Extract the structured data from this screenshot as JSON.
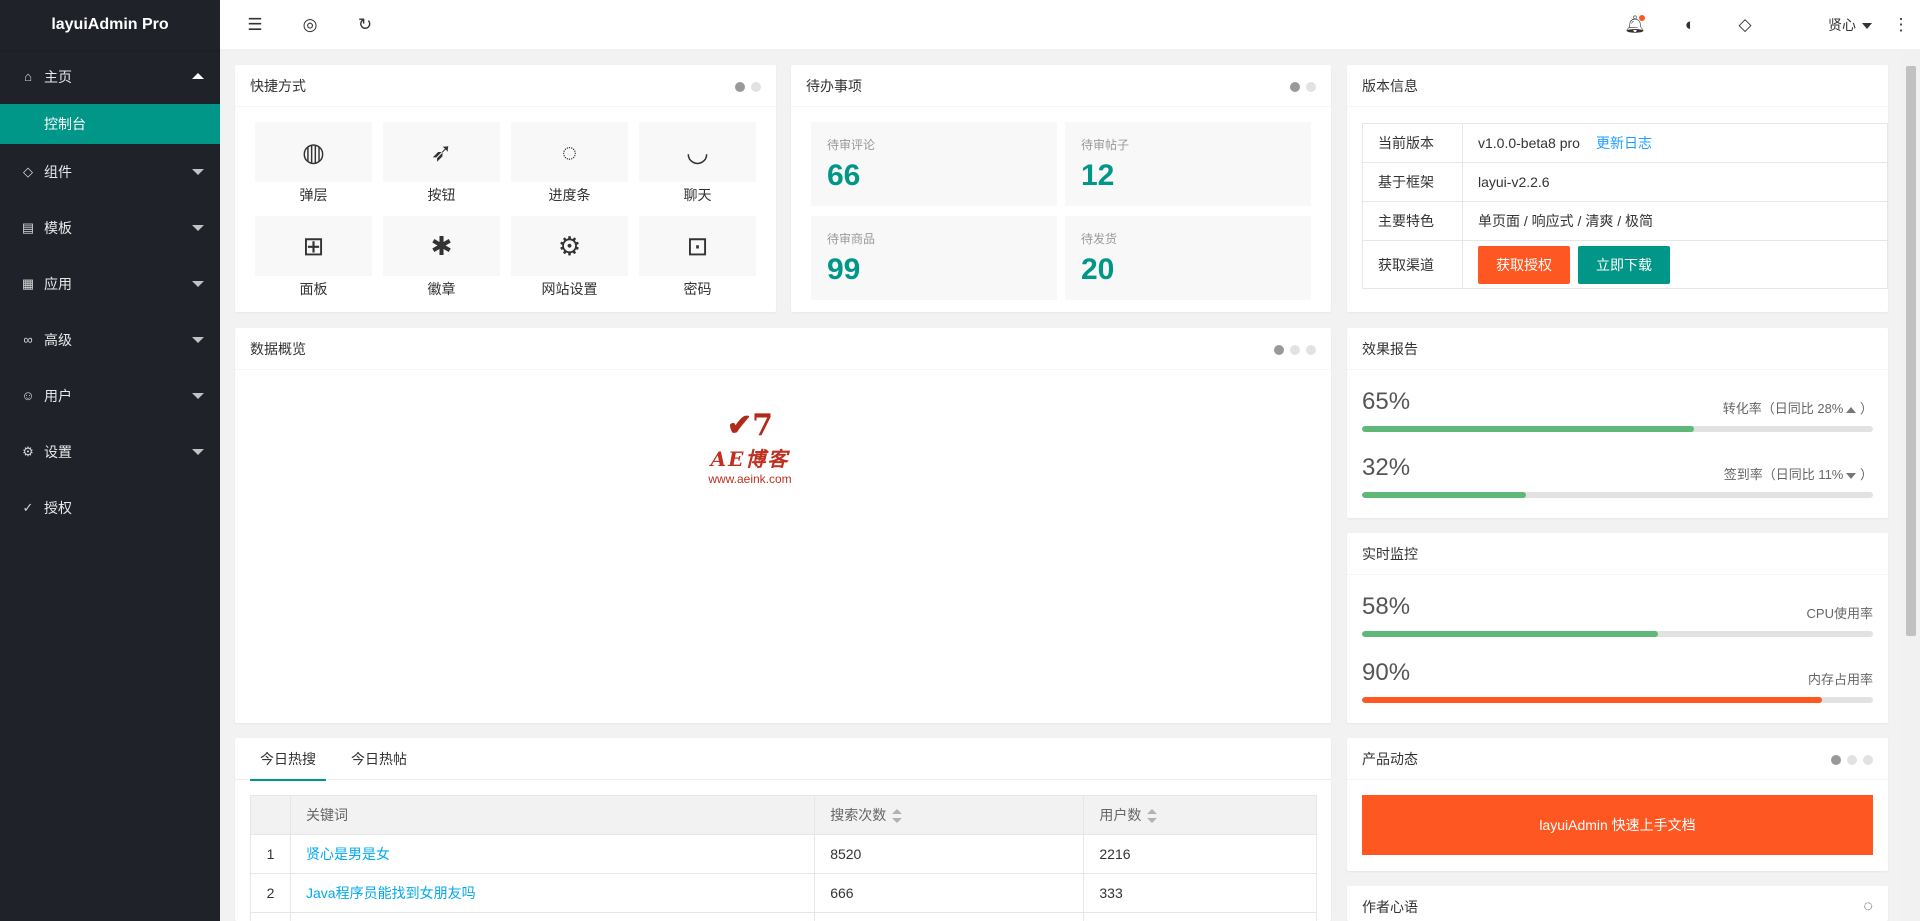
{
  "app": {
    "title": "layuiAdmin Pro"
  },
  "sidebar": {
    "items": [
      {
        "label": "主页",
        "icon": "home-icon",
        "glyph": "⌂",
        "expanded": true
      },
      {
        "label": "组件",
        "icon": "component-icon",
        "glyph": "◇"
      },
      {
        "label": "模板",
        "icon": "template-icon",
        "glyph": "▤"
      },
      {
        "label": "应用",
        "icon": "app-icon",
        "glyph": "▦"
      },
      {
        "label": "高级",
        "icon": "senior-icon",
        "glyph": "∞"
      },
      {
        "label": "用户",
        "icon": "user-icon",
        "glyph": "☺"
      },
      {
        "label": "设置",
        "icon": "settings-icon",
        "glyph": "⚙"
      },
      {
        "label": "授权",
        "icon": "auth-icon",
        "glyph": "✓"
      }
    ],
    "sub_active": "控制台"
  },
  "header": {
    "user": "贤心",
    "icons": [
      "shrink-icon",
      "website-icon",
      "refresh-icon",
      "notice-icon",
      "theme-icon",
      "note-icon",
      "more-icon"
    ]
  },
  "shortcuts": {
    "title": "快捷方式",
    "items": [
      {
        "label": "弹层",
        "icon": "globe-icon",
        "glyph": "◍"
      },
      {
        "label": "按钮",
        "icon": "compass-icon",
        "glyph": "➶"
      },
      {
        "label": "进度条",
        "icon": "loading-icon",
        "glyph": "◌"
      },
      {
        "label": "聊天",
        "icon": "chat-icon",
        "glyph": "◡"
      },
      {
        "label": "面板",
        "icon": "book-icon",
        "glyph": "⊞"
      },
      {
        "label": "徽章",
        "icon": "palm-icon",
        "glyph": "✱"
      },
      {
        "label": "网站设置",
        "icon": "gear-icon",
        "glyph": "⚙"
      },
      {
        "label": "密码",
        "icon": "lock-icon",
        "glyph": "⊡"
      }
    ]
  },
  "todo": {
    "title": "待办事项",
    "items": [
      {
        "label": "待审评论",
        "value": "66"
      },
      {
        "label": "待审帖子",
        "value": "12"
      },
      {
        "label": "待审商品",
        "value": "99"
      },
      {
        "label": "待发货",
        "value": "20"
      }
    ]
  },
  "version": {
    "title": "版本信息",
    "rows": [
      {
        "key": "当前版本",
        "value": "v1.0.0-beta8 pro",
        "link": "更新日志"
      },
      {
        "key": "基于框架",
        "value": "layui-v2.2.6"
      },
      {
        "key": "主要特色",
        "value": "单页面 / 响应式 / 清爽 / 极简"
      },
      {
        "key": "获取渠道",
        "btn1": "获取授权",
        "btn2": "立即下载"
      }
    ]
  },
  "overview": {
    "title": "数据概览",
    "watermark": {
      "mark": "✔7",
      "title": "AE博客",
      "url": "www.aeink.com"
    }
  },
  "effect": {
    "title": "效果报告",
    "rows": [
      {
        "value": "65%",
        "percent": 65,
        "label": "转化率（日同比 28%",
        "trend": "up"
      },
      {
        "value": "32%",
        "percent": 32,
        "label": "签到率（日同比 11%",
        "trend": "down"
      }
    ]
  },
  "monitor": {
    "title": "实时监控",
    "rows": [
      {
        "value": "58%",
        "percent": 58,
        "label": "CPU使用率",
        "color": "#5fb878"
      },
      {
        "value": "90%",
        "percent": 90,
        "label": "内存占用率",
        "color": "#ff5722"
      }
    ]
  },
  "hot": {
    "tabs": [
      "今日热搜",
      "今日热帖"
    ],
    "headers": [
      "关键词",
      "搜索次数",
      "用户数"
    ],
    "rows": [
      {
        "n": "1",
        "kw": "贤心是男是女",
        "search": "8520",
        "users": "2216"
      },
      {
        "n": "2",
        "kw": "Java程序员能找到女朋友吗",
        "search": "666",
        "users": "333"
      }
    ]
  },
  "product": {
    "title": "产品动态",
    "button": "layuiAdmin 快速上手文档"
  },
  "author": {
    "title": "作者心语"
  }
}
